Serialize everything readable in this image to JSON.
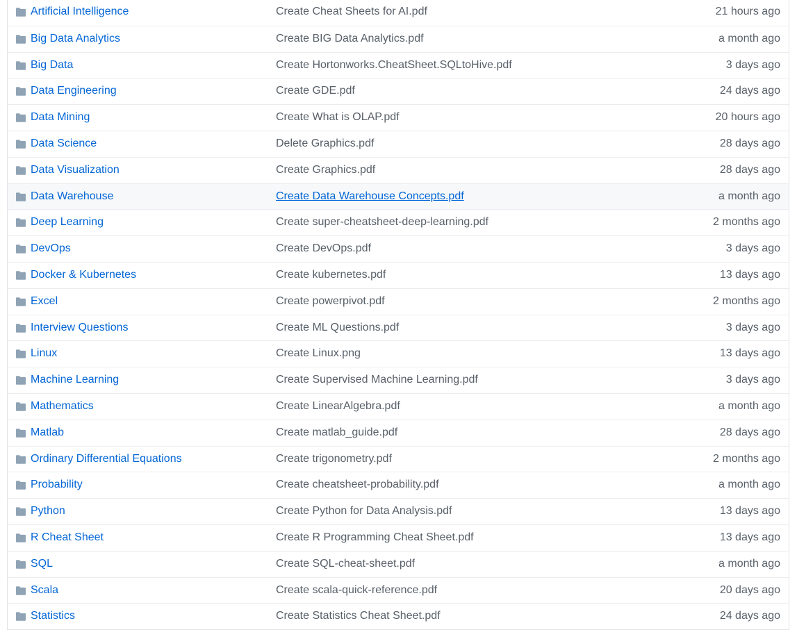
{
  "files": [
    {
      "name": "Artificial Intelligence",
      "message": "Create Cheat Sheets for AI.pdf",
      "age": "21 hours ago",
      "type": "folder-icon"
    },
    {
      "name": "Big Data Analytics",
      "message": "Create BIG Data Analytics.pdf",
      "age": "a month ago",
      "type": "folder-icon"
    },
    {
      "name": "Big Data",
      "message": "Create Hortonworks.CheatSheet.SQLtoHive.pdf",
      "age": "3 days ago",
      "type": "folder-icon"
    },
    {
      "name": "Data Engineering",
      "message": "Create GDE.pdf",
      "age": "24 days ago",
      "type": "folder-icon"
    },
    {
      "name": "Data Mining",
      "message": "Create What is OLAP.pdf",
      "age": "20 hours ago",
      "type": "folder-icon"
    },
    {
      "name": "Data Science",
      "message": "Delete Graphics.pdf",
      "age": "28 days ago",
      "type": "folder-icon"
    },
    {
      "name": "Data Visualization",
      "message": "Create Graphics.pdf",
      "age": "28 days ago",
      "type": "folder-icon"
    },
    {
      "name": "Data Warehouse",
      "message": "Create Data Warehouse Concepts.pdf",
      "age": "a month ago",
      "type": "folder-icon",
      "hovered": true
    },
    {
      "name": "Deep Learning",
      "message": "Create super-cheatsheet-deep-learning.pdf",
      "age": "2 months ago",
      "type": "folder-icon"
    },
    {
      "name": "DevOps",
      "message": "Create DevOps.pdf",
      "age": "3 days ago",
      "type": "folder-icon"
    },
    {
      "name": "Docker & Kubernetes",
      "message": "Create kubernetes.pdf",
      "age": "13 days ago",
      "type": "folder-icon"
    },
    {
      "name": "Excel",
      "message": "Create powerpivot.pdf",
      "age": "2 months ago",
      "type": "folder-icon"
    },
    {
      "name": "Interview Questions",
      "message": "Create ML Questions.pdf",
      "age": "3 days ago",
      "type": "folder-icon"
    },
    {
      "name": "Linux",
      "message": "Create Linux.png",
      "age": "13 days ago",
      "type": "folder-icon"
    },
    {
      "name": "Machine Learning",
      "message": "Create Supervised Machine Learning.pdf",
      "age": "3 days ago",
      "type": "folder-icon"
    },
    {
      "name": "Mathematics",
      "message": "Create LinearAlgebra.pdf",
      "age": "a month ago",
      "type": "folder-icon"
    },
    {
      "name": "Matlab",
      "message": "Create matlab_guide.pdf",
      "age": "28 days ago",
      "type": "folder-icon"
    },
    {
      "name": "Ordinary Differential Equations",
      "message": "Create trigonometry.pdf",
      "age": "2 months ago",
      "type": "folder-icon"
    },
    {
      "name": "Probability",
      "message": "Create cheatsheet-probability.pdf",
      "age": "a month ago",
      "type": "folder-icon"
    },
    {
      "name": "Python",
      "message": "Create Python for Data Analysis.pdf",
      "age": "13 days ago",
      "type": "folder-icon"
    },
    {
      "name": "R Cheat Sheet",
      "message": "Create R Programming Cheat Sheet.pdf",
      "age": "13 days ago",
      "type": "folder-icon"
    },
    {
      "name": "SQL",
      "message": "Create SQL-cheat-sheet.pdf",
      "age": "a month ago",
      "type": "folder-icon"
    },
    {
      "name": "Scala",
      "message": "Create scala-quick-reference.pdf",
      "age": "20 days ago",
      "type": "folder-icon"
    },
    {
      "name": "Statistics",
      "message": "Create Statistics Cheat Sheet.pdf",
      "age": "24 days ago",
      "type": "folder-icon"
    }
  ],
  "colors": {
    "link": "#0366d6",
    "muted": "#586069",
    "folder": "#79b8ff",
    "border": "#eaecef",
    "hover_bg": "#f6f8fa"
  }
}
